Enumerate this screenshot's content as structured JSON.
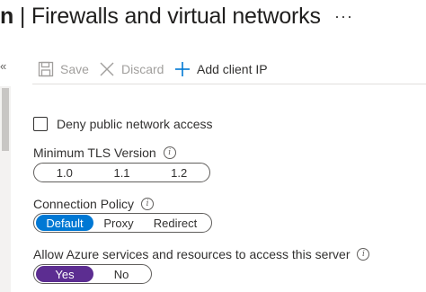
{
  "header": {
    "title_truncated": "n",
    "title_separator": "|",
    "title": "Firewalls and virtual networks",
    "more_icon": "ellipsis-icon"
  },
  "toolbar": {
    "save_label": "Save",
    "discard_label": "Discard",
    "add_client_ip_label": "Add client IP"
  },
  "public_access": {
    "label": "Deny public network access",
    "checked": false
  },
  "tls": {
    "label": "Minimum TLS Version",
    "options": [
      "1.0",
      "1.1",
      "1.2"
    ],
    "selected": ""
  },
  "connection_policy": {
    "label": "Connection Policy",
    "options": [
      "Default",
      "Proxy",
      "Redirect"
    ],
    "selected": "Default"
  },
  "azure_services": {
    "label": "Allow Azure services and resources to access this server",
    "options": [
      "Yes",
      "No"
    ],
    "selected": "Yes"
  },
  "colors": {
    "accent_blue": "#0078d4",
    "selected_purple": "#5c2d91"
  }
}
